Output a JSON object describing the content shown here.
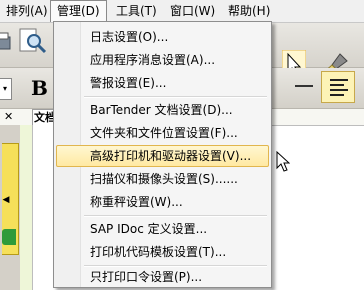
{
  "menubar": {
    "items": [
      "排列(A)",
      "管理(D)",
      "工具(T)",
      "窗口(W)",
      "帮助(H)"
    ]
  },
  "toolbar": {
    "bold_label": "B"
  },
  "document": {
    "tab_label": "文档"
  },
  "menu": {
    "items": [
      "日志设置(O)...",
      "应用程序消息设置(A)...",
      "警报设置(E)...",
      "BarTender 文档设置(D)...",
      "文件夹和文件位置设置(F)...",
      "高级打印机和驱动器设置(V)...",
      "扫描仪和摄像头设置(S)......",
      "称重秤设置(W)...",
      "SAP IDoc 定义设置...",
      "打印机代码模板设置(T)...",
      "只打印口令设置(P)..."
    ],
    "highlighted_index": 5
  },
  "colors": {
    "highlight": "#ffe9a2",
    "highlight_border": "#e1b64e"
  }
}
